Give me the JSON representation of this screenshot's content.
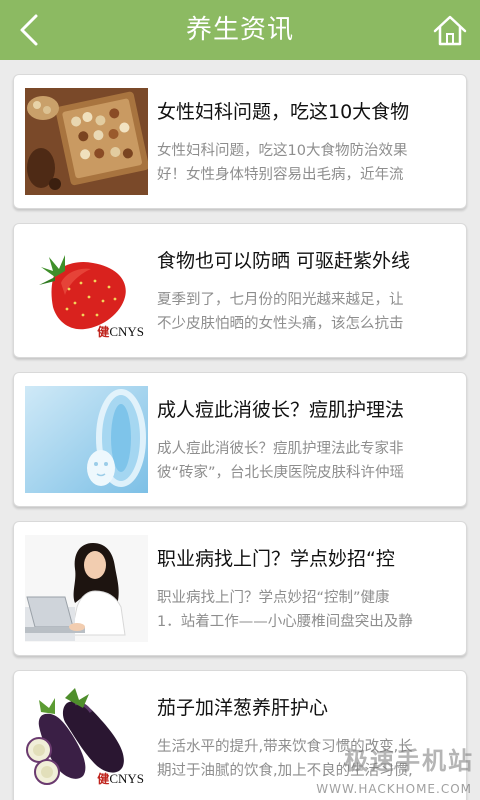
{
  "header": {
    "title": "养生资讯",
    "back_icon": "chevron-left-icon",
    "home_icon": "home-icon"
  },
  "articles": [
    {
      "title": "女性妇科问题，吃这10大食物",
      "line1": "女性妇科问题，吃这10大食物防治效果",
      "line2": "好！女性身体特别容易出毛病，近年流"
    },
    {
      "title": "食物也可以防晒 可驱赶紫外线",
      "line1": "夏季到了，七月份的阳光越来越足，让",
      "line2": "不少皮肤怕晒的女性头痛，该怎么抗击",
      "badge": "CNYS"
    },
    {
      "title": "成人痘此消彼长？痘肌护理法",
      "line1": "成人痘此消彼长？痘肌护理法此专家非",
      "line2": "彼“砖家”，台北长庚医院皮肤科许仲瑶"
    },
    {
      "title": "职业病找上门？学点妙招“控",
      "line1": "职业病找上门？学点妙招“控制”健康",
      "line2": "1．站着工作——小心腰椎间盘突出及静"
    },
    {
      "title": "茄子加洋葱养肝护心",
      "line1": "生活水平的提升,带来饮食习惯的改变,长",
      "line2": "期过于油腻的饮食,加上不良的生活习惯,",
      "badge": "CNYS"
    }
  ],
  "watermark": {
    "cn": "极速手机站",
    "url": "WWW.HACKHOME.COM"
  },
  "colors": {
    "header": "#8cba62",
    "background": "#ebebeb"
  }
}
